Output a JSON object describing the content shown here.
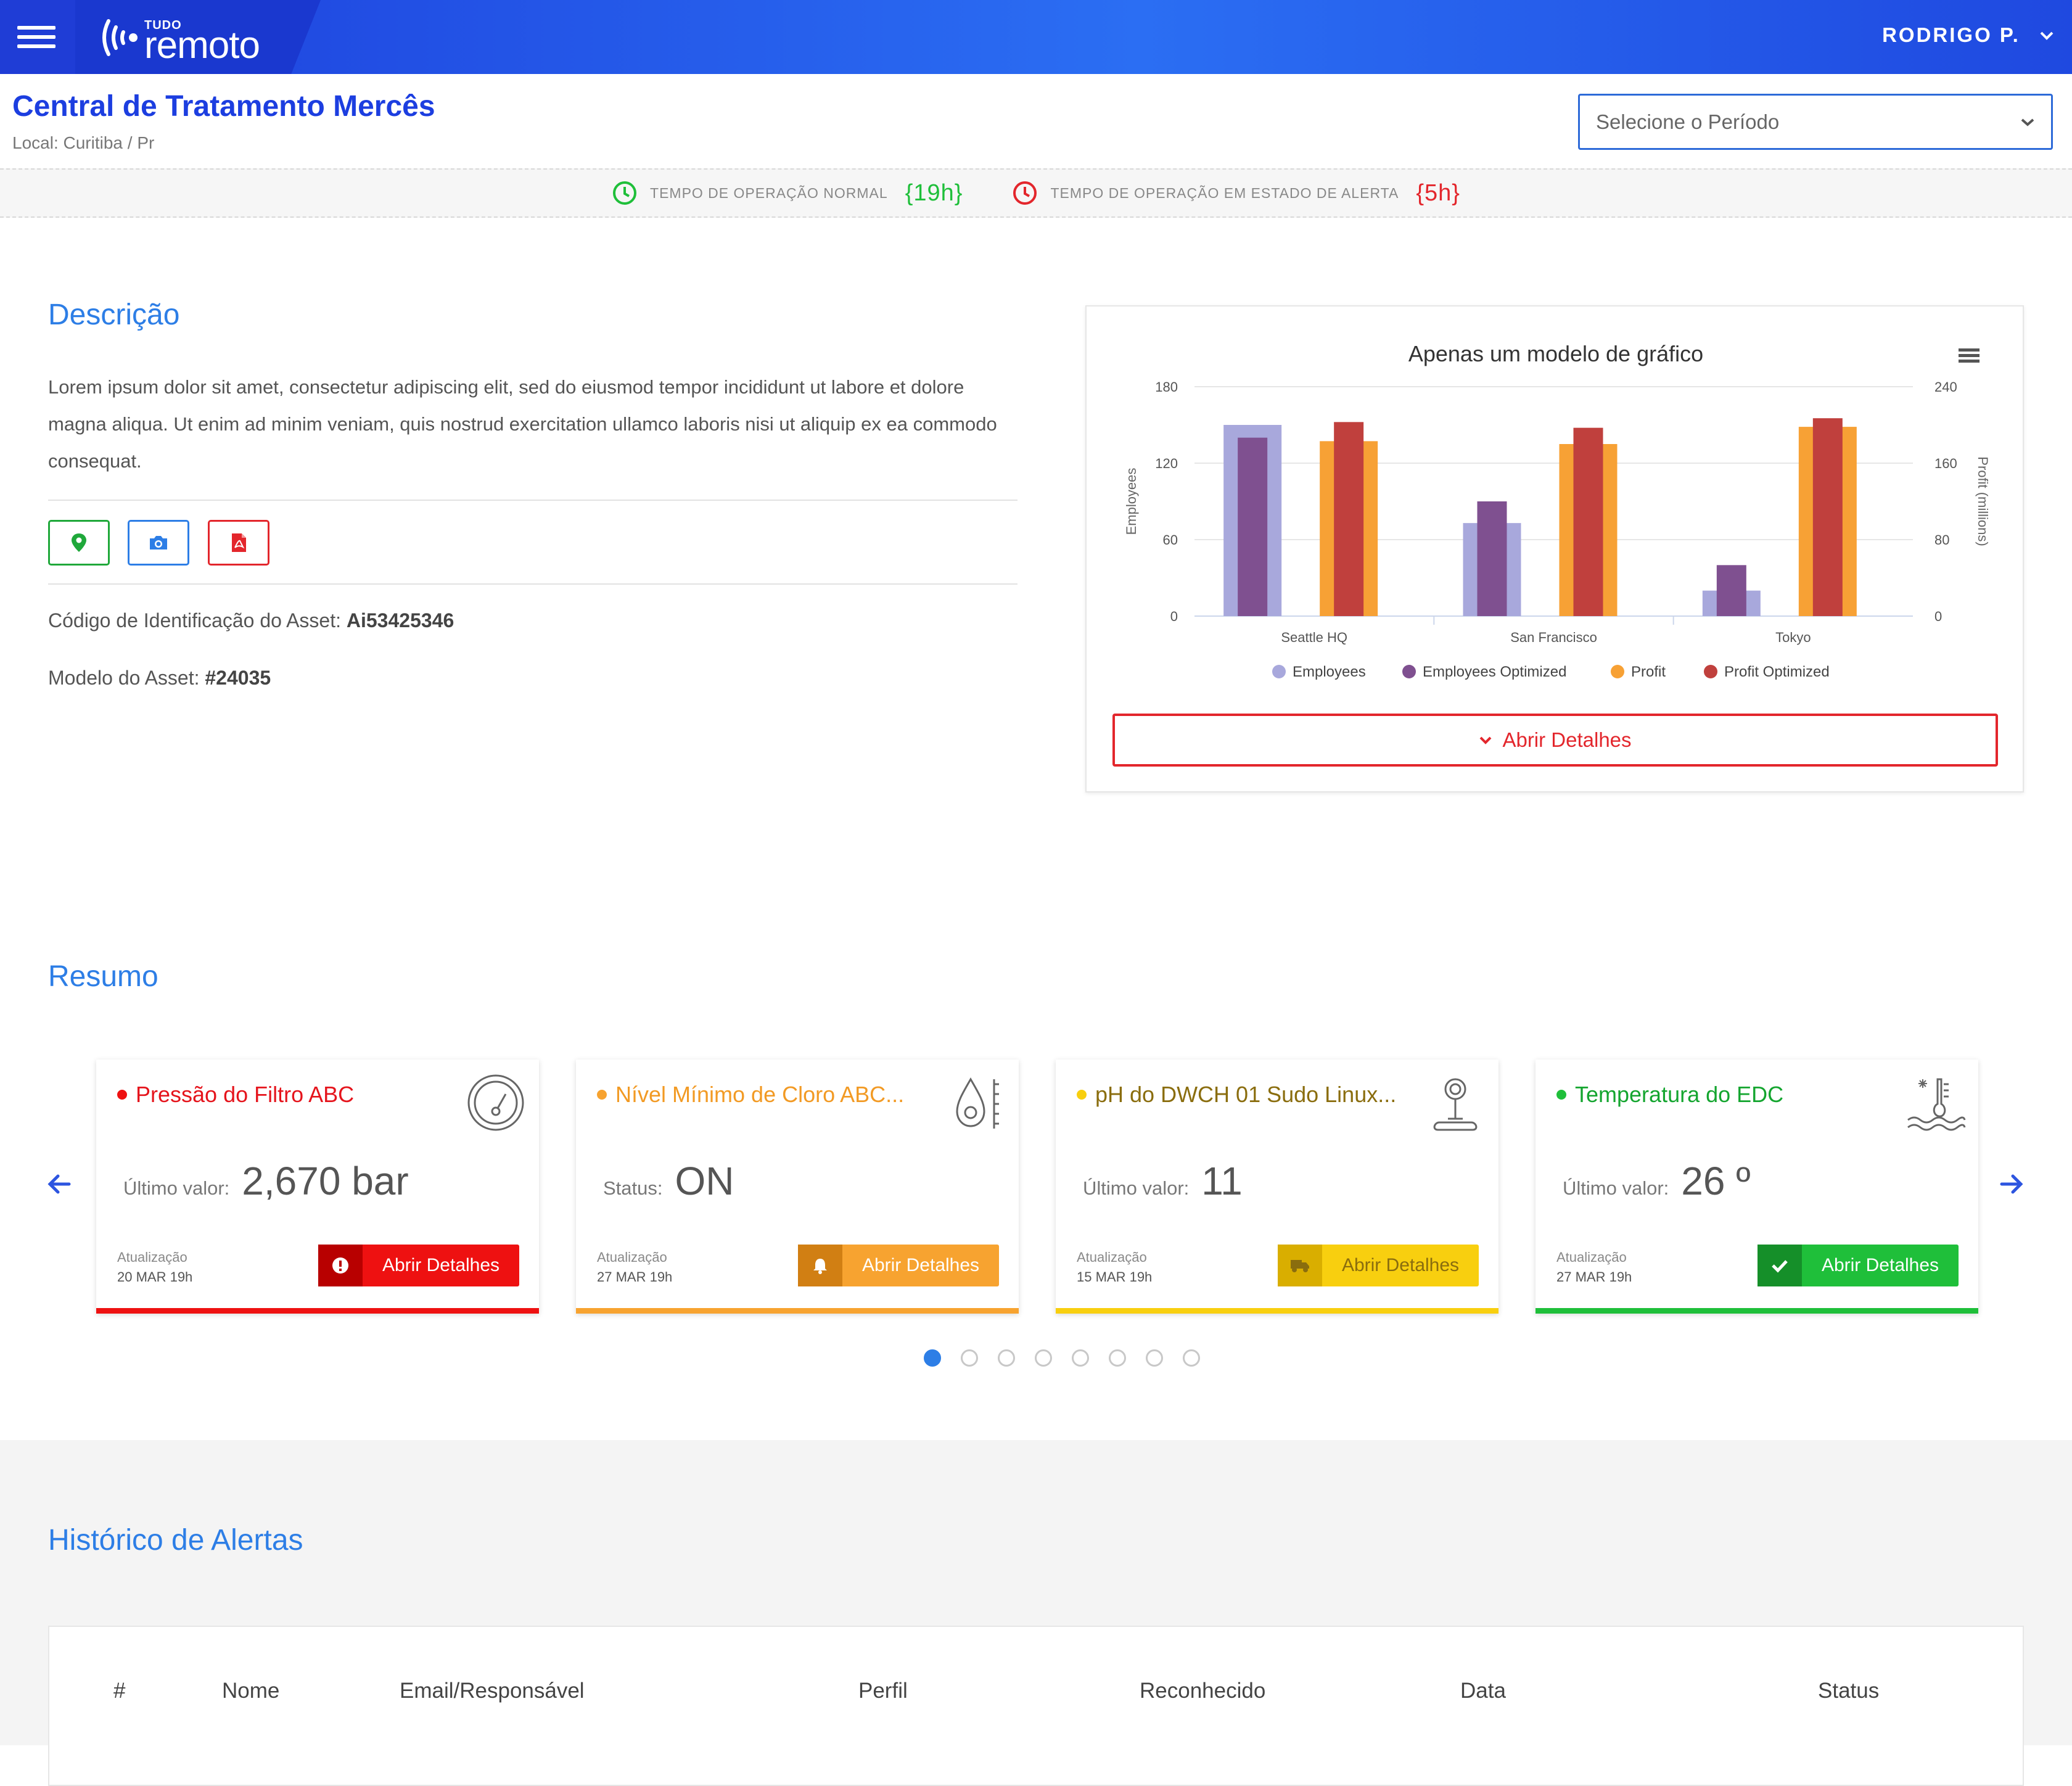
{
  "header": {
    "logo_top": "TUDO",
    "logo_main": "remoto",
    "user_name": "RODRIGO P."
  },
  "page": {
    "title": "Central de Tratamento Mercês",
    "location": "Local: Curitiba / Pr",
    "period_placeholder": "Selecione o Período"
  },
  "operation": {
    "normal_label": "TEMPO DE OPERAÇÃO NORMAL",
    "normal_value": "{19h}",
    "alert_label": "TEMPO DE OPERAÇÃO EM ESTADO DE ALERTA",
    "alert_value": "{5h}",
    "colors": {
      "normal": "#1fbf3a",
      "alert": "#e3262c"
    }
  },
  "description": {
    "title": "Descrição",
    "text": "Lorem ipsum dolor sit amet, consectetur adipiscing elit, sed do eiusmod tempor incididunt ut labore et dolore magna aliqua. Ut enim ad minim veniam, quis nostrud exercitation ullamco laboris nisi ut aliquip ex ea commodo consequat.",
    "icons": [
      "map-pin-icon",
      "camera-icon",
      "pdf-icon"
    ],
    "asset_code_label": "Código de Identificação do Asset:",
    "asset_code": "Ai53425346",
    "asset_model_label": "Modelo do Asset:",
    "asset_model": "#24035"
  },
  "chart_card": {
    "open_label": "Abrir Detalhes"
  },
  "chart_data": {
    "type": "bar",
    "title": "Apenas um modelo de gráfico",
    "categories": [
      "Seattle HQ",
      "San Francisco",
      "Tokyo"
    ],
    "ylabel": "Employees",
    "y2label": "Profit (millions)",
    "ylim": [
      0,
      180
    ],
    "y2lim": [
      0,
      240
    ],
    "yticks": [
      "0",
      "60",
      "120",
      "180"
    ],
    "y2ticks": [
      "0",
      "80",
      "160",
      "240"
    ],
    "series": [
      {
        "name": "Employees",
        "axis": "left",
        "values": [
          150,
          73,
          20
        ],
        "color": "#a8a8dc"
      },
      {
        "name": "Employees Optimized",
        "axis": "left",
        "values": [
          140,
          90,
          40
        ],
        "color": "#7f5090"
      },
      {
        "name": "Profit",
        "axis": "right",
        "values": [
          183,
          180,
          198
        ],
        "color": "#f7a135"
      },
      {
        "name": "Profit Optimized",
        "axis": "right",
        "values": [
          203,
          197,
          207
        ],
        "color": "#c0403d"
      }
    ],
    "legend": "bottom"
  },
  "summary": {
    "title": "Resumo",
    "cards": [
      {
        "title": "Pressão do Filtro ABC",
        "value_label": "Último valor:",
        "value": "2,670 bar",
        "updated_label": "Atualização",
        "updated": "20 MAR 19h",
        "button": "Abrir Detalhes",
        "color": "#ee1111",
        "title_color": "#e5141c",
        "button_icon": "alert-icon",
        "sensor_icon": "gauge-icon"
      },
      {
        "title": "Nível Mínimo de Cloro ABC...",
        "value_label": "Status:",
        "value": "ON",
        "updated_label": "Atualização",
        "updated": "27 MAR 19h",
        "button": "Abrir Detalhes",
        "color": "#f7a330",
        "title_color": "#f29a24",
        "button_icon": "bell-icon",
        "sensor_icon": "drop-level-icon"
      },
      {
        "title": "pH do DWCH 01 Sudo Linux...",
        "value_label": "Último valor:",
        "value": "11",
        "updated_label": "Atualização",
        "updated": "15 MAR 19h",
        "button": "Abrir Detalhes",
        "color": "#f8cf0f",
        "title_color": "#8a6d0e",
        "button_icon": "truck-icon",
        "sensor_icon": "ph-meter-icon"
      },
      {
        "title": "Temperatura do EDC",
        "value_label": "Último valor:",
        "value": "26 º",
        "updated_label": "Atualização",
        "updated": "27 MAR 19h",
        "button": "Abrir Detalhes",
        "color": "#1fbf3a",
        "title_color": "#14a52f",
        "button_icon": "check-icon",
        "sensor_icon": "water-temperature-icon"
      }
    ],
    "pages": 8,
    "active_page": 1
  },
  "history": {
    "title": "Histórico de Alertas",
    "columns": [
      "#",
      "Nome",
      "Email/Responsável",
      "Perfil",
      "Reconhecido",
      "Data",
      "Status"
    ]
  }
}
